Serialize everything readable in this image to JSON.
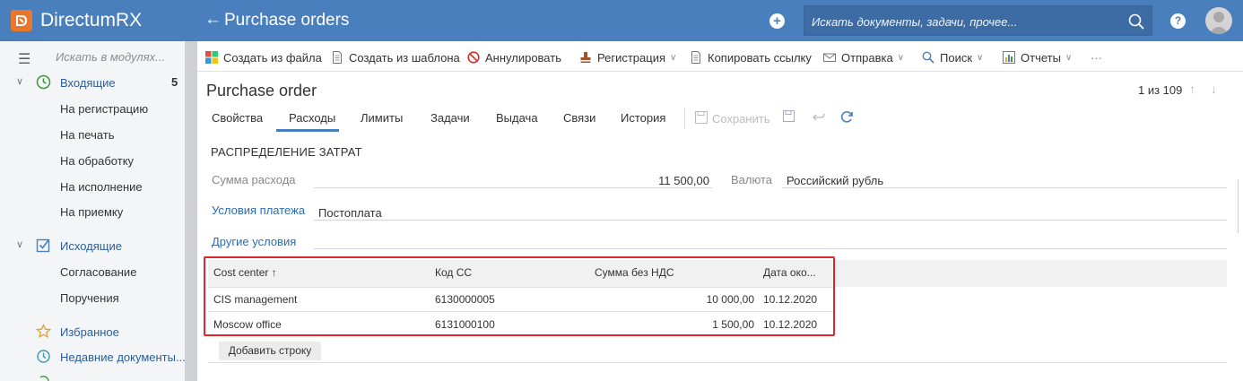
{
  "header": {
    "app_name": "DirectumRX",
    "back_arrow": "←",
    "page_title": "Purchase orders",
    "search_placeholder": "Искать документы, задачи, прочее...",
    "help_symbol": "?",
    "plus_symbol": "+",
    "accent": "#4a7fbd"
  },
  "sidebar": {
    "search_placeholder": "Искать в модулях...",
    "groups": [
      {
        "label": "Входящие",
        "count": "5",
        "icon": "clock-icon",
        "items": [
          "На регистрацию",
          "На печать",
          "На обработку",
          "На исполнение",
          "На приемку"
        ]
      },
      {
        "label": "Исходящие",
        "icon": "checkbox-icon",
        "items": [
          "Согласование",
          "Поручения"
        ]
      }
    ],
    "links": [
      {
        "label": "Избранное",
        "icon": "star-icon"
      },
      {
        "label": "Недавние документы...",
        "icon": "recent-docs-icon"
      }
    ]
  },
  "toolbar": {
    "create_from_file": "Создать из файла",
    "create_from_template": "Создать из шаблона",
    "annul": "Аннулировать",
    "registration": "Регистрация",
    "copy_link": "Копировать ссылку",
    "send": "Отправка",
    "search": "Поиск",
    "reports": "Отчеты",
    "more": "···"
  },
  "card": {
    "title": "Purchase order",
    "pager": "1 из 109",
    "tabs": [
      "Свойства",
      "Расходы",
      "Лимиты",
      "Задачи",
      "Выдача",
      "Связи",
      "История"
    ],
    "active_tab": "Расходы",
    "save_label": "Сохранить"
  },
  "section": {
    "title": "РАСПРЕДЕЛЕНИЕ ЗАТРАТ",
    "amount_label": "Сумма расхода",
    "amount_value": "11 500,00",
    "currency_label": "Валюта",
    "currency_value": "Российский рубль",
    "payment_terms_label": "Условия платежа",
    "payment_terms_value": "Постоплата",
    "other_terms_label": "Другие условия",
    "other_terms_value": ""
  },
  "table": {
    "columns": [
      "Cost center ↑",
      "Код СС",
      "Сумма без НДС",
      "Дата око..."
    ],
    "rows": [
      {
        "cost_center": "CIS management",
        "code": "6130000005",
        "amount": "10 000,00",
        "date": "10.12.2020"
      },
      {
        "cost_center": "Moscow office",
        "code": "6131000100",
        "amount": "1 500,00",
        "date": "10.12.2020"
      }
    ],
    "add_row": "Добавить строку",
    "highlight_color": "#e0262d"
  }
}
